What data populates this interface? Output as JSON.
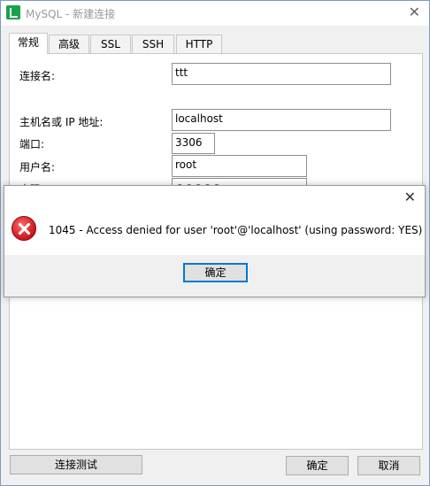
{
  "window": {
    "title": "MySQL - 新建连接"
  },
  "tabs": [
    {
      "label": "常规"
    },
    {
      "label": "高级"
    },
    {
      "label": "SSL"
    },
    {
      "label": "SSH"
    },
    {
      "label": "HTTP"
    }
  ],
  "form": {
    "conn_name_label": "连接名:",
    "conn_name_value": "ttt",
    "host_label": "主机名或 IP 地址:",
    "host_value": "localhost",
    "port_label": "端口:",
    "port_value": "3306",
    "user_label": "用户名:",
    "user_value": "root",
    "password_label": "密码",
    "password_value": "●●●●●"
  },
  "buttons": {
    "test": "连接测试",
    "ok": "确定",
    "cancel": "取消"
  },
  "dialog": {
    "message": "1045 - Access denied for user 'root'@'localhost' (using password: YES)",
    "ok": "确定"
  }
}
